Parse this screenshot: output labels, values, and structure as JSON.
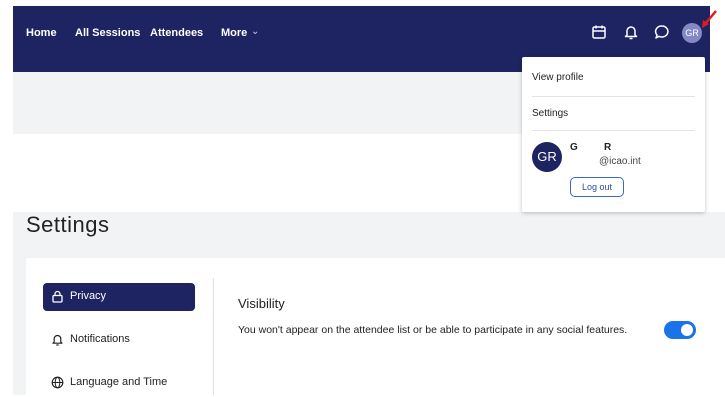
{
  "topbar": {
    "nav": [
      "Home",
      "All Sessions",
      "Attendees",
      "More"
    ],
    "avatar_initials": "GR",
    "icons": [
      "calendar-icon",
      "bell-icon",
      "chat-icon"
    ],
    "background_color": "#1e2461"
  },
  "dropdown": {
    "view_profile": "View profile",
    "settings": "Settings",
    "avatar_initials": "GR",
    "first_initial": "G",
    "last_initial": "R",
    "email": "@icao.int",
    "logout": "Log out"
  },
  "page": {
    "title": "Settings"
  },
  "sidebar": {
    "items": [
      {
        "label": "Privacy",
        "icon": "lock-icon",
        "active": true
      },
      {
        "label": "Notifications",
        "icon": "bell-icon",
        "active": false
      },
      {
        "label": "Language and Time",
        "icon": "globe-icon",
        "active": false
      }
    ]
  },
  "visibility": {
    "title": "Visibility",
    "description": "You won't appear on the attendee list or be able to participate in any social features.",
    "toggle_on": true,
    "toggle_color": "#1a73e8"
  }
}
